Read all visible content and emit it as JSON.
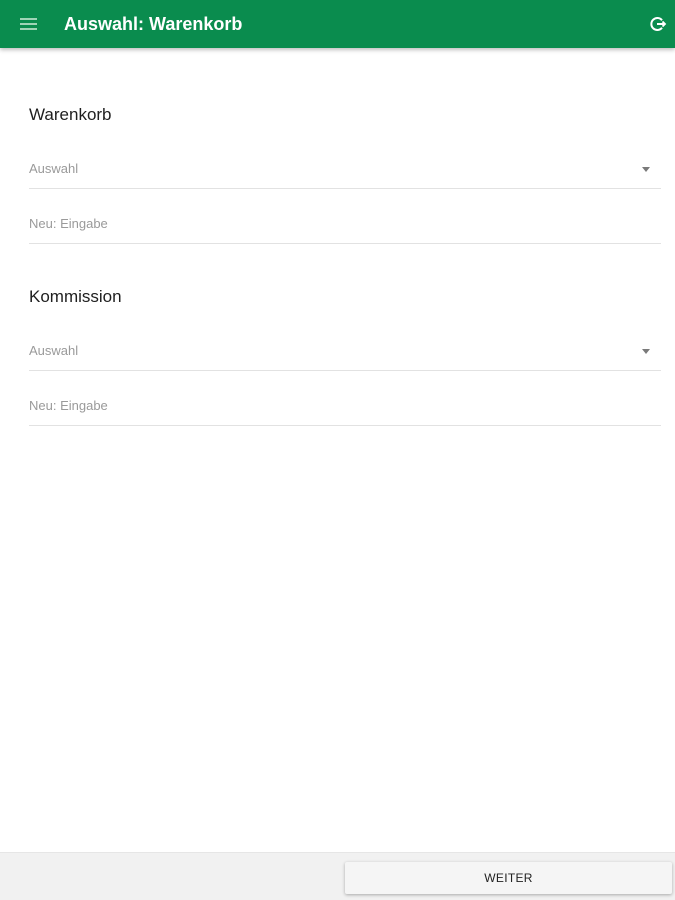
{
  "appbar": {
    "title": "Auswahl: Warenkorb",
    "background": "#0a8c4e",
    "menu_icon": "hamburger-menu-icon",
    "logout_icon": "logout-icon"
  },
  "sections": [
    {
      "title": "Warenkorb",
      "select_placeholder": "Auswahl",
      "input_placeholder": "Neu: Eingabe"
    },
    {
      "title": "Kommission",
      "select_placeholder": "Auswahl",
      "input_placeholder": "Neu: Eingabe"
    }
  ],
  "footer": {
    "next_label": "WEITER"
  }
}
